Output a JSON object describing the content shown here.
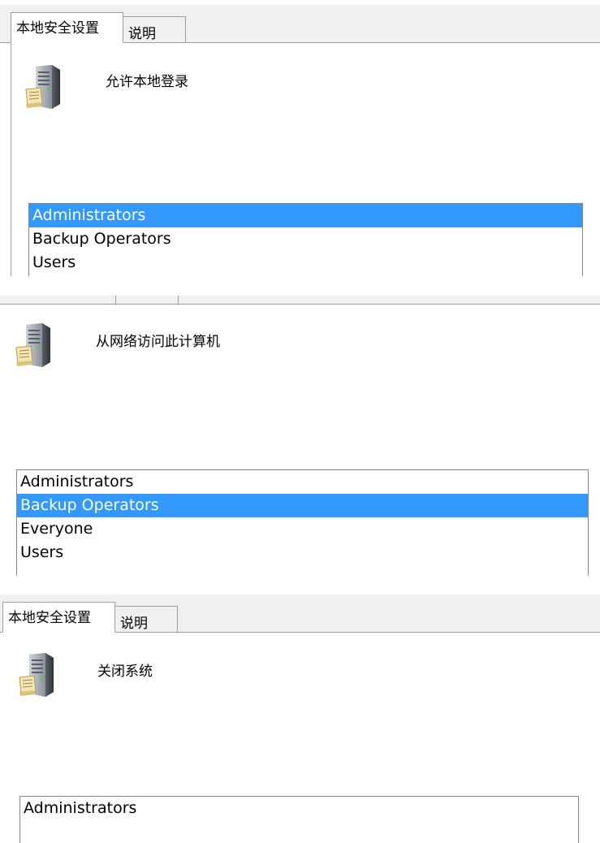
{
  "panels": [
    {
      "tabs": [
        {
          "label": "本地安全设置",
          "active": true
        },
        {
          "label": "说明",
          "active": false
        }
      ],
      "icon": "server-policy-icon",
      "title": "允许本地登录",
      "list": {
        "items": [
          "Administrators",
          "Backup Operators",
          "Users"
        ],
        "selected_index": 0
      }
    },
    {
      "tabs": [],
      "icon": "server-policy-icon",
      "title": "从网络访问此计算机",
      "list": {
        "items": [
          "Administrators",
          "Backup Operators",
          "Everyone",
          "Users"
        ],
        "selected_index": 1
      }
    },
    {
      "tabs": [
        {
          "label": "本地安全设置",
          "active": true
        },
        {
          "label": "说明",
          "active": false
        }
      ],
      "icon": "server-policy-icon",
      "title": "关闭系统",
      "list": {
        "items": [
          "Administrators"
        ],
        "selected_index": -1
      }
    }
  ],
  "colors": {
    "selection": "#3399ff",
    "tab_bg": "#f0f0f0",
    "border": "#a0a0a0"
  }
}
